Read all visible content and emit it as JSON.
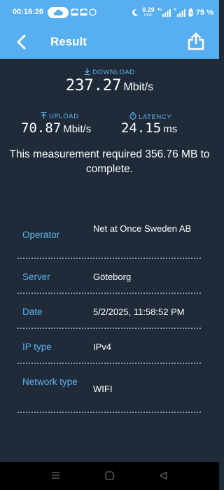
{
  "status_bar": {
    "time": "00:16:26",
    "network_speed_value": "0.29",
    "network_speed_unit": "KB/S",
    "signal_label_1": "4G",
    "signal_label_2": "R",
    "battery": "75 %",
    "icons": [
      "cloud-icon",
      "notification-icon",
      "notification-icon",
      "whatsapp-icon",
      "moon-icon",
      "signal-icon",
      "signal-icon",
      "battery-icon"
    ]
  },
  "header": {
    "title": "Result",
    "back_icon": "chevron-left-icon",
    "share_icon": "share-icon"
  },
  "results": {
    "download_label": "DOWNLOAD",
    "download_value": "237.27",
    "download_unit": "Mbit/s",
    "upload_label": "UPLOAD",
    "upload_value": "70.87",
    "upload_unit": "Mbit/s",
    "latency_label": "LATENCY",
    "latency_value": "24.15",
    "latency_unit": "ms",
    "measurement_text": "This measurement required 356.76 MB to complete."
  },
  "info": [
    {
      "key": "Operator",
      "value": "Net at Once Sweden AB"
    },
    {
      "key": "Server",
      "value": "Göteborg"
    },
    {
      "key": "Date",
      "value": "5/2/2025, 11:58:52 PM"
    },
    {
      "key": "IP type",
      "value": "IPv4"
    },
    {
      "key": "Network type",
      "value": "WIFI"
    }
  ],
  "colors": {
    "accent": "#57aef0",
    "label_blue": "#5fb0ee",
    "background": "#1f2b38"
  }
}
